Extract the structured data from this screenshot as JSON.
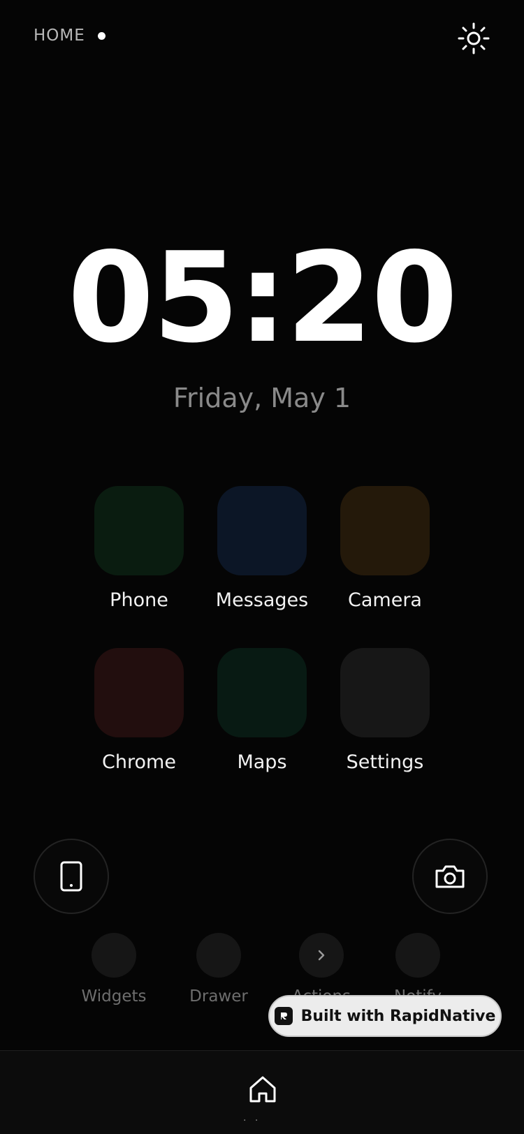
{
  "header": {
    "home_label": "HOME",
    "theme_icon": "sun-icon"
  },
  "clock": {
    "time": "05:20",
    "date": "Friday, May 1"
  },
  "apps": [
    {
      "label": "Phone",
      "color": "#0a1c10"
    },
    {
      "label": "Messages",
      "color": "#0c1626"
    },
    {
      "label": "Camera",
      "color": "#24190a"
    },
    {
      "label": "Chrome",
      "color": "#220e0e"
    },
    {
      "label": "Maps",
      "color": "#081a13"
    },
    {
      "label": "Settings",
      "color": "#171717"
    }
  ],
  "shortcuts": {
    "left_icon": "phone-device-icon",
    "right_icon": "camera-icon"
  },
  "quick_actions": [
    {
      "label": "Widgets"
    },
    {
      "label": "Drawer"
    },
    {
      "label": "Actions",
      "icon": "chevron-right-icon"
    },
    {
      "label": "Notify"
    }
  ],
  "badge": {
    "text": "Built with RapidNative",
    "logo": "rapidnative-logo-icon"
  },
  "bottom_nav": {
    "icon": "home-icon",
    "indicator": ". ."
  }
}
